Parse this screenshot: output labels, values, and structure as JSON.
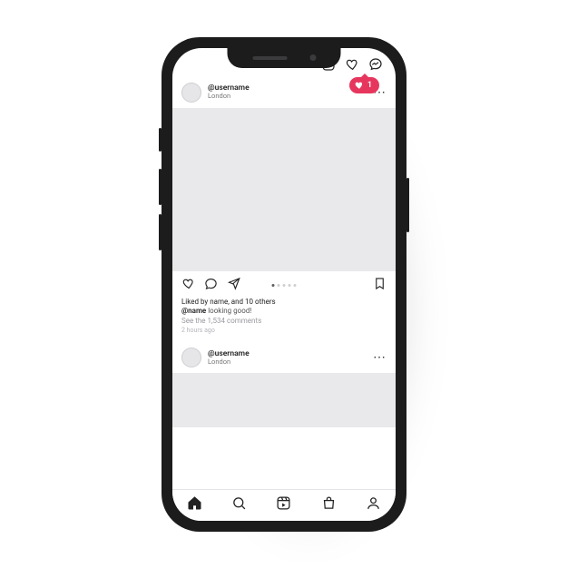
{
  "notification": {
    "count": "1"
  },
  "posts": [
    {
      "username": "@username",
      "location": "London",
      "liked_text": "Liked by name, and 10 others",
      "caption_user": "@name",
      "caption_text": " looking good!",
      "comments_line": "See the 1,534 comments",
      "time": "2 hours ago"
    },
    {
      "username": "@username",
      "location": "London"
    }
  ],
  "icons": {
    "add": "add-post-icon",
    "activity": "heart-outline-icon",
    "messages": "messenger-icon",
    "like": "heart-icon",
    "comment": "comment-icon",
    "share": "share-icon",
    "save": "bookmark-icon",
    "home": "home-icon",
    "search": "search-icon",
    "reels": "reels-icon",
    "shop": "shop-icon",
    "profile": "profile-icon"
  }
}
